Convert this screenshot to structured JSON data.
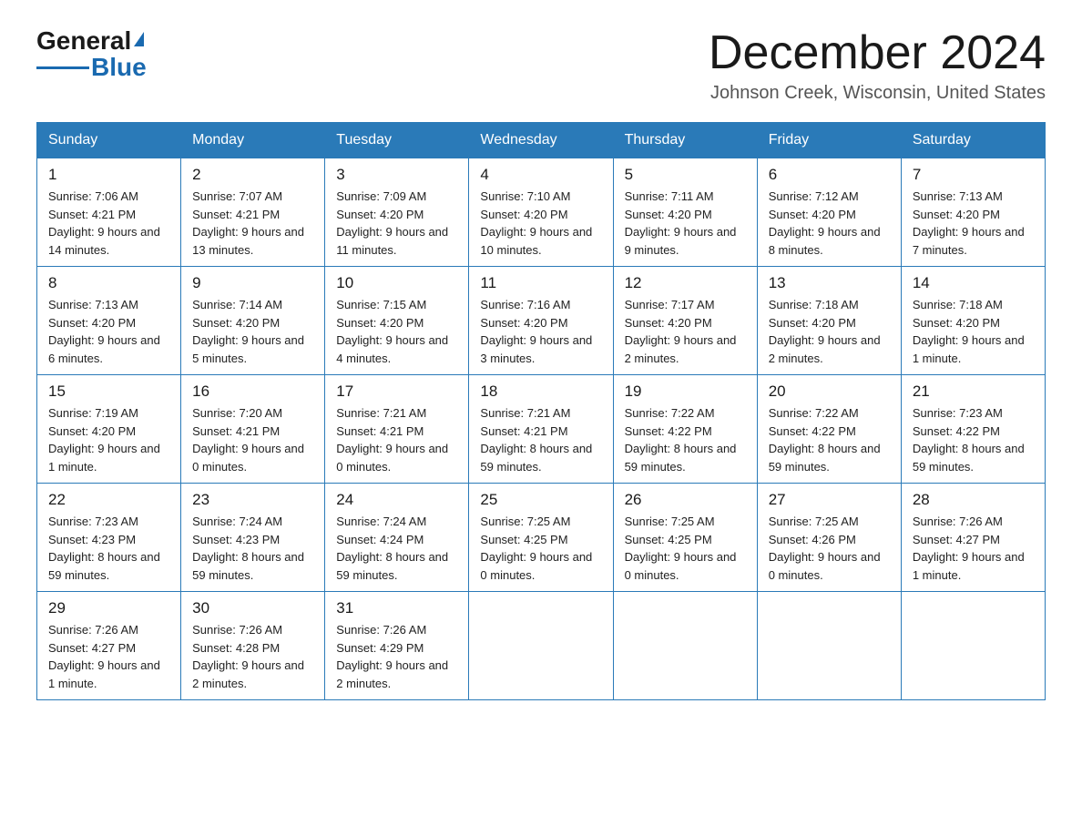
{
  "logo": {
    "general": "General",
    "blue": "Blue"
  },
  "header": {
    "month": "December 2024",
    "location": "Johnson Creek, Wisconsin, United States"
  },
  "days_of_week": [
    "Sunday",
    "Monday",
    "Tuesday",
    "Wednesday",
    "Thursday",
    "Friday",
    "Saturday"
  ],
  "weeks": [
    [
      {
        "day": "1",
        "sunrise": "7:06 AM",
        "sunset": "4:21 PM",
        "daylight": "9 hours and 14 minutes."
      },
      {
        "day": "2",
        "sunrise": "7:07 AM",
        "sunset": "4:21 PM",
        "daylight": "9 hours and 13 minutes."
      },
      {
        "day": "3",
        "sunrise": "7:09 AM",
        "sunset": "4:20 PM",
        "daylight": "9 hours and 11 minutes."
      },
      {
        "day": "4",
        "sunrise": "7:10 AM",
        "sunset": "4:20 PM",
        "daylight": "9 hours and 10 minutes."
      },
      {
        "day": "5",
        "sunrise": "7:11 AM",
        "sunset": "4:20 PM",
        "daylight": "9 hours and 9 minutes."
      },
      {
        "day": "6",
        "sunrise": "7:12 AM",
        "sunset": "4:20 PM",
        "daylight": "9 hours and 8 minutes."
      },
      {
        "day": "7",
        "sunrise": "7:13 AM",
        "sunset": "4:20 PM",
        "daylight": "9 hours and 7 minutes."
      }
    ],
    [
      {
        "day": "8",
        "sunrise": "7:13 AM",
        "sunset": "4:20 PM",
        "daylight": "9 hours and 6 minutes."
      },
      {
        "day": "9",
        "sunrise": "7:14 AM",
        "sunset": "4:20 PM",
        "daylight": "9 hours and 5 minutes."
      },
      {
        "day": "10",
        "sunrise": "7:15 AM",
        "sunset": "4:20 PM",
        "daylight": "9 hours and 4 minutes."
      },
      {
        "day": "11",
        "sunrise": "7:16 AM",
        "sunset": "4:20 PM",
        "daylight": "9 hours and 3 minutes."
      },
      {
        "day": "12",
        "sunrise": "7:17 AM",
        "sunset": "4:20 PM",
        "daylight": "9 hours and 2 minutes."
      },
      {
        "day": "13",
        "sunrise": "7:18 AM",
        "sunset": "4:20 PM",
        "daylight": "9 hours and 2 minutes."
      },
      {
        "day": "14",
        "sunrise": "7:18 AM",
        "sunset": "4:20 PM",
        "daylight": "9 hours and 1 minute."
      }
    ],
    [
      {
        "day": "15",
        "sunrise": "7:19 AM",
        "sunset": "4:20 PM",
        "daylight": "9 hours and 1 minute."
      },
      {
        "day": "16",
        "sunrise": "7:20 AM",
        "sunset": "4:21 PM",
        "daylight": "9 hours and 0 minutes."
      },
      {
        "day": "17",
        "sunrise": "7:21 AM",
        "sunset": "4:21 PM",
        "daylight": "9 hours and 0 minutes."
      },
      {
        "day": "18",
        "sunrise": "7:21 AM",
        "sunset": "4:21 PM",
        "daylight": "8 hours and 59 minutes."
      },
      {
        "day": "19",
        "sunrise": "7:22 AM",
        "sunset": "4:22 PM",
        "daylight": "8 hours and 59 minutes."
      },
      {
        "day": "20",
        "sunrise": "7:22 AM",
        "sunset": "4:22 PM",
        "daylight": "8 hours and 59 minutes."
      },
      {
        "day": "21",
        "sunrise": "7:23 AM",
        "sunset": "4:22 PM",
        "daylight": "8 hours and 59 minutes."
      }
    ],
    [
      {
        "day": "22",
        "sunrise": "7:23 AM",
        "sunset": "4:23 PM",
        "daylight": "8 hours and 59 minutes."
      },
      {
        "day": "23",
        "sunrise": "7:24 AM",
        "sunset": "4:23 PM",
        "daylight": "8 hours and 59 minutes."
      },
      {
        "day": "24",
        "sunrise": "7:24 AM",
        "sunset": "4:24 PM",
        "daylight": "8 hours and 59 minutes."
      },
      {
        "day": "25",
        "sunrise": "7:25 AM",
        "sunset": "4:25 PM",
        "daylight": "9 hours and 0 minutes."
      },
      {
        "day": "26",
        "sunrise": "7:25 AM",
        "sunset": "4:25 PM",
        "daylight": "9 hours and 0 minutes."
      },
      {
        "day": "27",
        "sunrise": "7:25 AM",
        "sunset": "4:26 PM",
        "daylight": "9 hours and 0 minutes."
      },
      {
        "day": "28",
        "sunrise": "7:26 AM",
        "sunset": "4:27 PM",
        "daylight": "9 hours and 1 minute."
      }
    ],
    [
      {
        "day": "29",
        "sunrise": "7:26 AM",
        "sunset": "4:27 PM",
        "daylight": "9 hours and 1 minute."
      },
      {
        "day": "30",
        "sunrise": "7:26 AM",
        "sunset": "4:28 PM",
        "daylight": "9 hours and 2 minutes."
      },
      {
        "day": "31",
        "sunrise": "7:26 AM",
        "sunset": "4:29 PM",
        "daylight": "9 hours and 2 minutes."
      },
      null,
      null,
      null,
      null
    ]
  ]
}
